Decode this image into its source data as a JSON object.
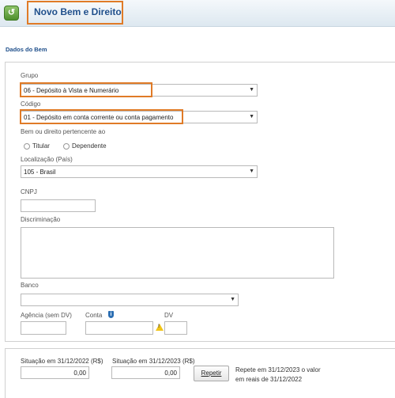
{
  "header": {
    "title": "Novo Bem e Direito",
    "back_icon": "refresh-back-icon"
  },
  "section": {
    "title": "Dados do Bem"
  },
  "form": {
    "grupo_label": "Grupo",
    "grupo_value": "06 - Depósito à Vista e Numerário",
    "codigo_label": "Código",
    "codigo_value": "01 - Depósito em conta corrente ou conta pagamento",
    "pertencente_label": "Bem ou direito pertencente ao",
    "option_titular": "Titular",
    "option_dependente": "Dependente",
    "localizacao_label": "Localização (País)",
    "localizacao_value": "105 - Brasil",
    "cnpj_label": "CNPJ",
    "discriminacao_label": "Discriminação",
    "banco_label": "Banco",
    "agencia_label": "Agência (sem DV)",
    "conta_label": "Conta",
    "dv_label": "DV"
  },
  "situacao": {
    "label_2022": "Situação em 31/12/2022 (R$)",
    "value_2022": "0,00",
    "label_2023": "Situação em 31/12/2023 (R$)",
    "value_2023": "0,00",
    "repetir_label": "Repetir",
    "repetir_note_1": "Repete em 31/12/2023 o valor",
    "repetir_note_2": "em reais de 31/12/2022"
  },
  "colors": {
    "highlight": "#e07b27",
    "title": "#1f4f8b"
  }
}
